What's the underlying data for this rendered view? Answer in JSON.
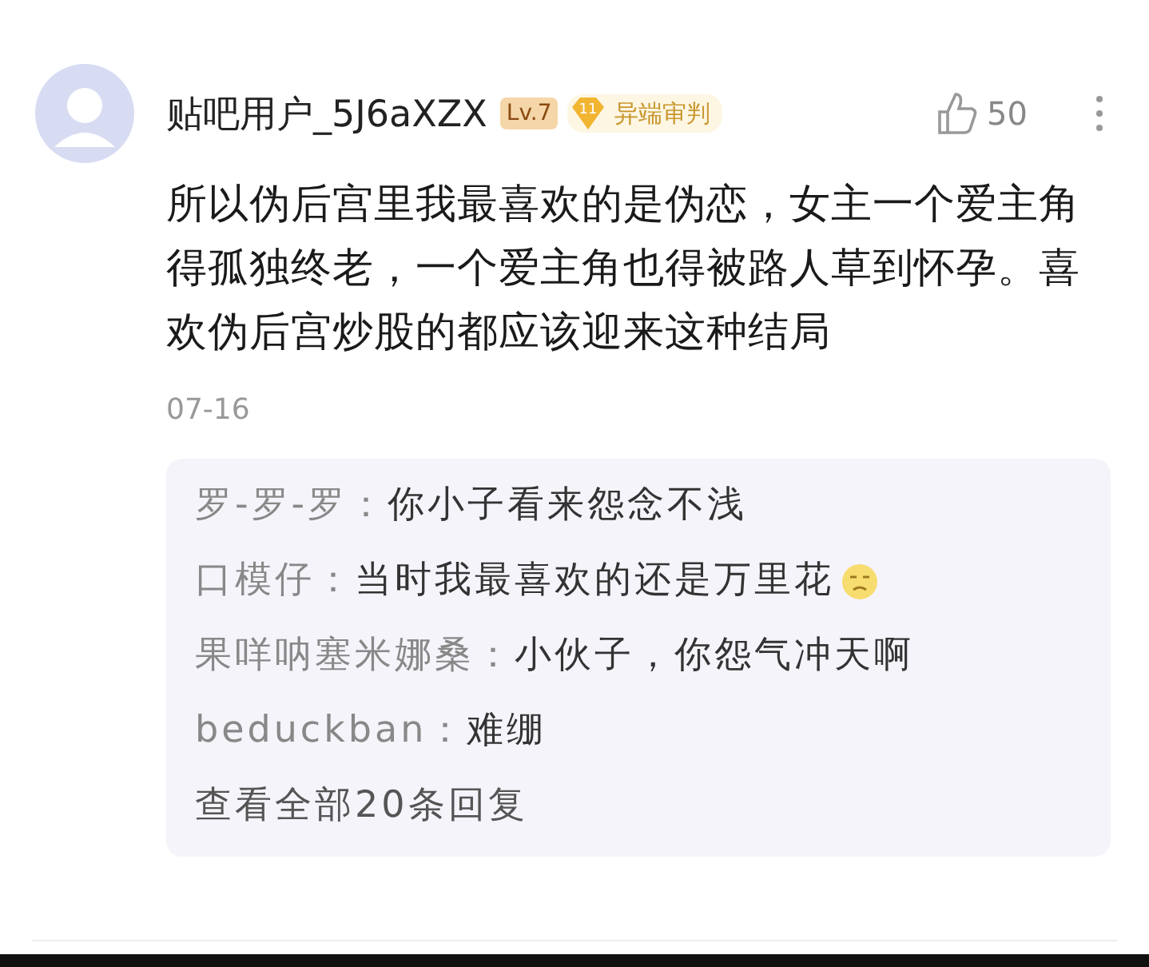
{
  "comment": {
    "username": "贴吧用户_5J6aXZX",
    "level_badge": "Lv.7",
    "medal": {
      "number": "11",
      "title": "异端审判"
    },
    "likes": "50",
    "text": "所以伪后宫里我最喜欢的是伪恋，女主一个爱主角得孤独终老，一个爱主角也得被路人草到怀孕。喜欢伪后宫炒股的都应该迎来这种结局",
    "date": "07-16"
  },
  "replies": [
    {
      "author": "罗-罗-罗：",
      "text": "你小子看来怨念不浅",
      "emoji": false
    },
    {
      "author": "口模仔：",
      "text": "当时我最喜欢的还是万里花",
      "emoji": true
    },
    {
      "author": "果咩呐塞米娜桑：",
      "text": "小伙子，你怨气冲天啊",
      "emoji": false
    },
    {
      "author": "beduckban：",
      "text": "难绷",
      "emoji": false
    }
  ],
  "view_all": "查看全部20条回复"
}
